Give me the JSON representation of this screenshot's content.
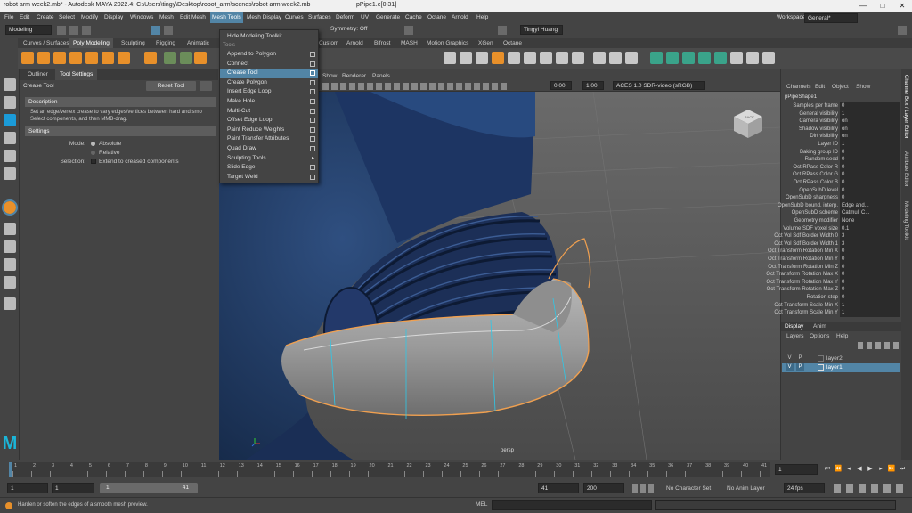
{
  "titlebar": {
    "left": "robot arm week2.mb* - Autodesk MAYA 2022.4: C:\\Users\\tingy\\Desktop\\robot_arm\\scenes\\robot arm week2.mb",
    "center": "pPipe1.e[0:31]",
    "minimize": "—",
    "maximize": "□",
    "close": "✕"
  },
  "menubar": {
    "items": [
      "File",
      "Edit",
      "Create",
      "Select",
      "Modify",
      "Display",
      "Windows",
      "Mesh",
      "Edit Mesh",
      "Mesh Tools",
      "Mesh Display",
      "Curves",
      "Surfaces",
      "Deform",
      "UV",
      "Generate",
      "Cache",
      "Octane",
      "Arnold",
      "Help"
    ],
    "workspace_label": "Workspace:",
    "workspace_value": "General*"
  },
  "statusline": {
    "mode": "Modeling",
    "symmetry": "Symmetry: Off",
    "user": "Tingyi Huang"
  },
  "shelf": {
    "tabs": [
      "Curves / Surfaces",
      "Poly Modeling",
      "Sculpting",
      "Rigging",
      "Animatic",
      "Custom",
      "Arnold",
      "Bifrost",
      "MASH",
      "Motion Graphics",
      "XGen",
      "Octane"
    ],
    "active_tab": "Poly Modeling"
  },
  "tool_settings": {
    "tabs": [
      "Outliner",
      "Tool Settings"
    ],
    "tool_name": "Crease Tool",
    "reset_label": "Reset Tool",
    "description_header": "Description",
    "description_text_1": "Set an edge/vertex crease to vary edges/vertices between hard and smo",
    "description_text_2": "Select components, and then MMB-drag.",
    "settings_header": "Settings",
    "mode_label": "Mode:",
    "mode_absolute": "Absolute",
    "mode_relative": "Relative",
    "selection_label": "Selection:",
    "selection_option": "Extend to creased components"
  },
  "mesh_tools_menu": {
    "top_item": "Hide Modeling Toolkit",
    "section": "Tools",
    "items": [
      "Append to Polygon",
      "Connect",
      "Crease Tool",
      "Create Polygon",
      "Insert Edge Loop",
      "Make Hole",
      "Multi-Cut",
      "Offset Edge Loop",
      "Paint Reduce Weights",
      "Paint Transfer Attributes",
      "Quad Draw",
      "Sculpting Tools",
      "Slide Edge",
      "Target Weld"
    ],
    "highlighted": "Crease Tool"
  },
  "viewport": {
    "menu": [
      "Show",
      "Renderer",
      "Panels"
    ],
    "value_a": "0.00",
    "value_b": "1.00",
    "colorspace": "ACES 1.0 SDR-video (sRGB)",
    "camera_label": "persp",
    "viewcube_label": "BACK"
  },
  "channel_box": {
    "menu": [
      "Channels",
      "Edit",
      "Object",
      "Show"
    ],
    "object_name": "pPipeShape1",
    "rows": [
      {
        "label": "Samples per frame",
        "value": "0"
      },
      {
        "label": "General visibility",
        "value": "1"
      },
      {
        "label": "Camera visibility",
        "value": "on"
      },
      {
        "label": "Shadow visibility",
        "value": "on"
      },
      {
        "label": "Dirt visibility",
        "value": "on"
      },
      {
        "label": "Layer ID",
        "value": "1"
      },
      {
        "label": "Baking group ID",
        "value": "0"
      },
      {
        "label": "Random seed",
        "value": "0"
      },
      {
        "label": "Oct RPass Color R",
        "value": "0"
      },
      {
        "label": "Oct RPass Color G",
        "value": "0"
      },
      {
        "label": "Oct RPass Color B",
        "value": "0"
      },
      {
        "label": "OpenSubD level",
        "value": "0"
      },
      {
        "label": "OpenSubD sharpness",
        "value": "0"
      },
      {
        "label": "OpenSubD bound. interp.",
        "value": "Edge and..."
      },
      {
        "label": "OpenSubD scheme",
        "value": "Catmull C..."
      },
      {
        "label": "Geometry modifier",
        "value": "None"
      },
      {
        "label": "Volume SDF voxel size",
        "value": "0.1"
      },
      {
        "label": "Oct Vol Sdf Border Width 0",
        "value": "3"
      },
      {
        "label": "Oct Vol Sdf Border Width 1",
        "value": "3"
      },
      {
        "label": "Oct Transform Rotation Min X",
        "value": "0"
      },
      {
        "label": "Oct Transform Rotation Min Y",
        "value": "0"
      },
      {
        "label": "Oct Transform Rotation Min Z",
        "value": "0"
      },
      {
        "label": "Oct Transform Rotation Max X",
        "value": "0"
      },
      {
        "label": "Oct Transform Rotation Max Y",
        "value": "0"
      },
      {
        "label": "Oct Transform Rotation Max Z",
        "value": "0"
      },
      {
        "label": "Rotation step",
        "value": "0"
      },
      {
        "label": "Oct Transform Scale Min X",
        "value": "1"
      },
      {
        "label": "Oct Transform Scale Min Y",
        "value": "1"
      }
    ],
    "side_labels": [
      "Channel Box / Layer Editor",
      "Attribute Editor",
      "Modeling Toolkit"
    ]
  },
  "layers": {
    "tabs": [
      "Display",
      "Anim"
    ],
    "menu": [
      "Layers",
      "Options",
      "Help"
    ],
    "rows": [
      {
        "v": "V",
        "p": "P",
        "name": "layer2",
        "selected": false
      },
      {
        "v": "V",
        "p": "P",
        "name": "layer1",
        "selected": true
      }
    ]
  },
  "time_slider": {
    "ticks": [
      "1",
      "2",
      "3",
      "4",
      "5",
      "6",
      "7",
      "8",
      "9",
      "10",
      "11",
      "12",
      "13",
      "14",
      "15",
      "16",
      "17",
      "18",
      "19",
      "20",
      "21",
      "22",
      "23",
      "24",
      "25",
      "26",
      "27",
      "28",
      "29",
      "30",
      "31",
      "32",
      "33",
      "34",
      "35",
      "36",
      "37",
      "38",
      "39",
      "40",
      "41"
    ],
    "current_frame": "1"
  },
  "range_slider": {
    "start": "1",
    "playback_start": "1",
    "range_start_label": "1",
    "range_end_label": "41",
    "playback_end": "41",
    "end": "200",
    "character_set": "No Character Set",
    "anim_layer": "No Anim Layer",
    "fps": "24 fps"
  },
  "helpline": {
    "text": "Harden or soften the edges of a smooth mesh preview.",
    "mel_label": "MEL"
  },
  "logo": "M"
}
